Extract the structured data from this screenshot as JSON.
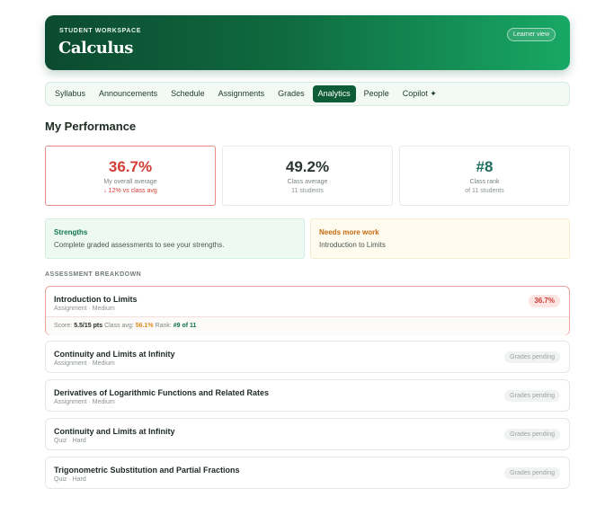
{
  "header": {
    "eyebrow": "STUDENT WORKSPACE",
    "title": "Calculus",
    "learner_view": "Learner view"
  },
  "tabs": [
    {
      "label": "Syllabus",
      "active": false
    },
    {
      "label": "Announcements",
      "active": false
    },
    {
      "label": "Schedule",
      "active": false
    },
    {
      "label": "Assignments",
      "active": false
    },
    {
      "label": "Grades",
      "active": false
    },
    {
      "label": "Analytics",
      "active": true
    },
    {
      "label": "People",
      "active": false
    },
    {
      "label": "Copilot ✦",
      "active": false
    }
  ],
  "performance": {
    "title": "My Performance",
    "stats": [
      {
        "value": "36.7%",
        "label": "My overall average",
        "sub": "↓ 12% vs class avg",
        "value_color": "#d43c36",
        "sub_color": "#d43c36"
      },
      {
        "value": "49.2%",
        "label": "Class average",
        "sub": "11 students",
        "value_color": "#2b3530",
        "sub_color": "#8a948f"
      },
      {
        "value": "#8",
        "label": "Class rank",
        "sub": "of 11 students",
        "value_color": "#1d6e5e",
        "sub_color": "#8a948f"
      }
    ],
    "strengths": {
      "title": "Strengths",
      "text": "Complete graded assessments to see your strengths.",
      "title_color": "#11784e"
    },
    "needs_work": {
      "title": "Needs more work",
      "text": "Introduction to Limits",
      "title_color": "#c46a10"
    }
  },
  "breakdown": {
    "title": "ASSESSMENT BREAKDOWN",
    "open_item": {
      "name": "Introduction to Limits",
      "meta": "Assignment · Medium",
      "score_pill": "36.7%",
      "score_label": "Score:",
      "score_value": "5.5/15 pts",
      "class_avg_label": "Class avg:",
      "class_avg_value": "56.1%",
      "rank_label": "Rank:",
      "rank_value": "#9 of 11"
    },
    "items": [
      {
        "name": "Continuity and Limits at Infinity",
        "meta": "Assignment · Medium",
        "status": "Grades pending"
      },
      {
        "name": "Derivatives of Logarithmic Functions and Related Rates",
        "meta": "Assignment · Medium",
        "status": "Grades pending"
      },
      {
        "name": "Continuity and Limits at Infinity",
        "meta": "Quiz · Hard",
        "status": "Grades pending"
      },
      {
        "name": "Trigonometric Substitution and Partial Fractions",
        "meta": "Quiz · Hard",
        "status": "Grades pending"
      }
    ]
  }
}
